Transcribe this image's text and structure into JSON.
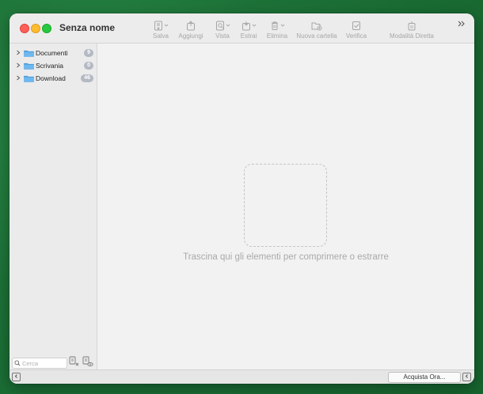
{
  "window": {
    "title": "Senza nome"
  },
  "toolbar": {
    "items": [
      {
        "label": "Salva",
        "icon": "save-icon"
      },
      {
        "label": "Aggiungi",
        "icon": "add-icon"
      },
      {
        "label": "Vista",
        "icon": "view-icon"
      },
      {
        "label": "Estrai",
        "icon": "extract-icon"
      },
      {
        "label": "Elimina",
        "icon": "trash-icon"
      },
      {
        "label": "Nuova cartella",
        "icon": "new-folder-icon"
      },
      {
        "label": "Verifica",
        "icon": "verify-icon"
      },
      {
        "label": "Modalità Diretta",
        "icon": "direct-mode-icon"
      }
    ],
    "overflow_icon": "chevrons-right-icon"
  },
  "sidebar": {
    "items": [
      {
        "label": "Documenti",
        "count": "9"
      },
      {
        "label": "Scrivania",
        "count": "0"
      },
      {
        "label": "Download",
        "count": "46"
      }
    ],
    "search_placeholder": "Cerca"
  },
  "main": {
    "drop_hint": "Trascina qui gli elementi per comprimere o estrarre"
  },
  "bottombar": {
    "buy_label": "Acquista Ora..."
  },
  "colors": {
    "folder": "#5aa9e6",
    "badge": "#b4b9c3",
    "background": "#1f7a3c"
  }
}
